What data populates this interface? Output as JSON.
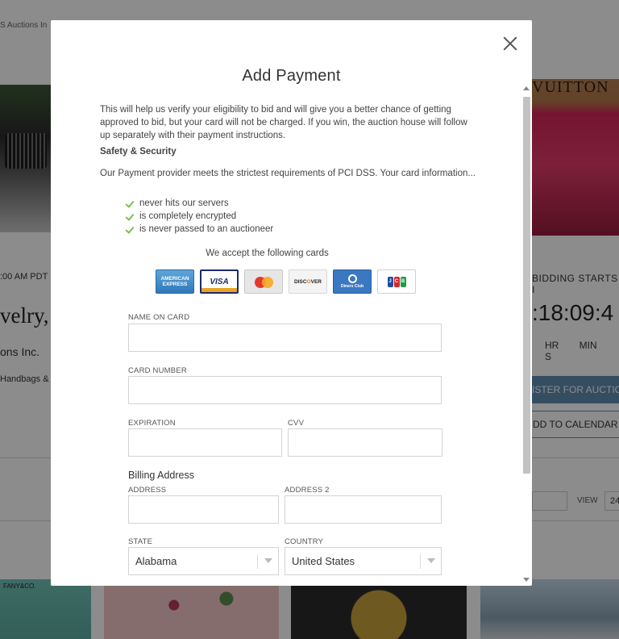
{
  "background": {
    "breadcrumb": "S Auctions In",
    "brand_text": "VUITTON",
    "left_time": ":00 AM PDT",
    "left_title": "velry,",
    "left_house": "ons Inc.",
    "left_category": "Handbags &",
    "right_bidding": "BIDDING STARTS I",
    "right_countdown": ":18:09:4",
    "right_units": "HR MIN S",
    "register_button": "ISTER FOR AUCTIO",
    "calendar_button": "DD TO CALENDAR",
    "view_label": "VIEW",
    "view_value": "24",
    "tiffany_text": "FANY&CO."
  },
  "modal": {
    "title": "Add Payment",
    "intro": "This will help us verify your eligibility to bid and will give you a better chance of getting approved to bid, but your card will not be charged. If you win, the auction house will follow up separately with their payment instructions.",
    "safety_heading": "Safety & Security",
    "pci_text": "Our Payment provider meets the strictest requirements of PCI DSS. Your card information...",
    "checklist": [
      "never hits our servers",
      "is completely encrypted",
      "is never passed to an auctioneer"
    ],
    "cards_label": "We accept the following cards",
    "cards": {
      "amex": "AMERICAN EXPRESS",
      "visa": "VISA",
      "discover_pre": "DISC",
      "discover_o": "O",
      "discover_post": "VER",
      "diners": "Diners Club",
      "jcb": [
        "J",
        "C",
        "B"
      ]
    },
    "form": {
      "name_label": "NAME ON CARD",
      "name_value": "",
      "number_label": "CARD NUMBER",
      "number_value": "",
      "expiration_label": "EXPIRATION",
      "expiration_value": "",
      "cvv_label": "CVV",
      "cvv_value": "",
      "billing_heading": "Billing Address",
      "address_label": "ADDRESS",
      "address_value": "",
      "address2_label": "ADDRESS 2",
      "address2_value": "",
      "state_label": "STATE",
      "state_value": "Alabama",
      "country_label": "COUNTRY",
      "country_value": "United States"
    }
  }
}
